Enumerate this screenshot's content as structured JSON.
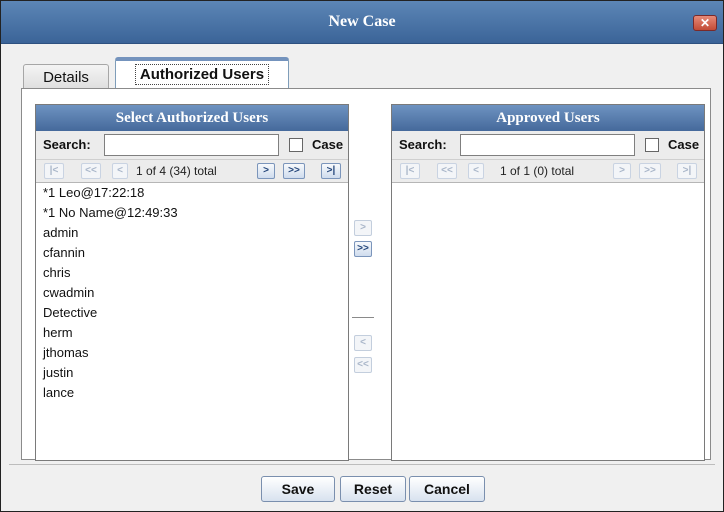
{
  "window": {
    "title": "New Case",
    "close_glyph": "✕"
  },
  "tabs": [
    {
      "label": "Details",
      "selected": false
    },
    {
      "label": "Authorized Users",
      "selected": true
    }
  ],
  "left_panel": {
    "header": "Select Authorized Users",
    "search_label": "Search:",
    "search_value": "",
    "case_label": "Case",
    "case_checked": false,
    "pager": {
      "first": "|<",
      "prev_page": "<<",
      "prev": "<",
      "text": "1 of 4 (34) total",
      "next": ">",
      "next_page": ">>",
      "last": ">|"
    },
    "items": [
      "*1 Leo@17:22:18",
      "*1 No Name@12:49:33",
      "admin",
      "cfannin",
      "chris",
      "cwadmin",
      "Detective",
      "herm",
      "jthomas",
      "justin",
      "lance"
    ]
  },
  "right_panel": {
    "header": "Approved Users",
    "search_label": "Search:",
    "search_value": "",
    "case_label": "Case",
    "case_checked": false,
    "pager": {
      "first": "|<",
      "prev_page": "<<",
      "prev": "<",
      "text": "1 of 1 (0) total",
      "next": ">",
      "next_page": ">>",
      "last": ">|"
    },
    "items": []
  },
  "transfer": {
    "add": ">",
    "add_all": ">>",
    "remove": "<",
    "remove_all": "<<"
  },
  "footer": {
    "save": "Save",
    "reset": "Reset",
    "cancel": "Cancel"
  },
  "colors": {
    "title_bar": "#3b6498",
    "panel_header": "#45699b",
    "close_button": "#c24c37",
    "pager_active": "#23457a",
    "pager_disabled": "#a9b6c9"
  }
}
